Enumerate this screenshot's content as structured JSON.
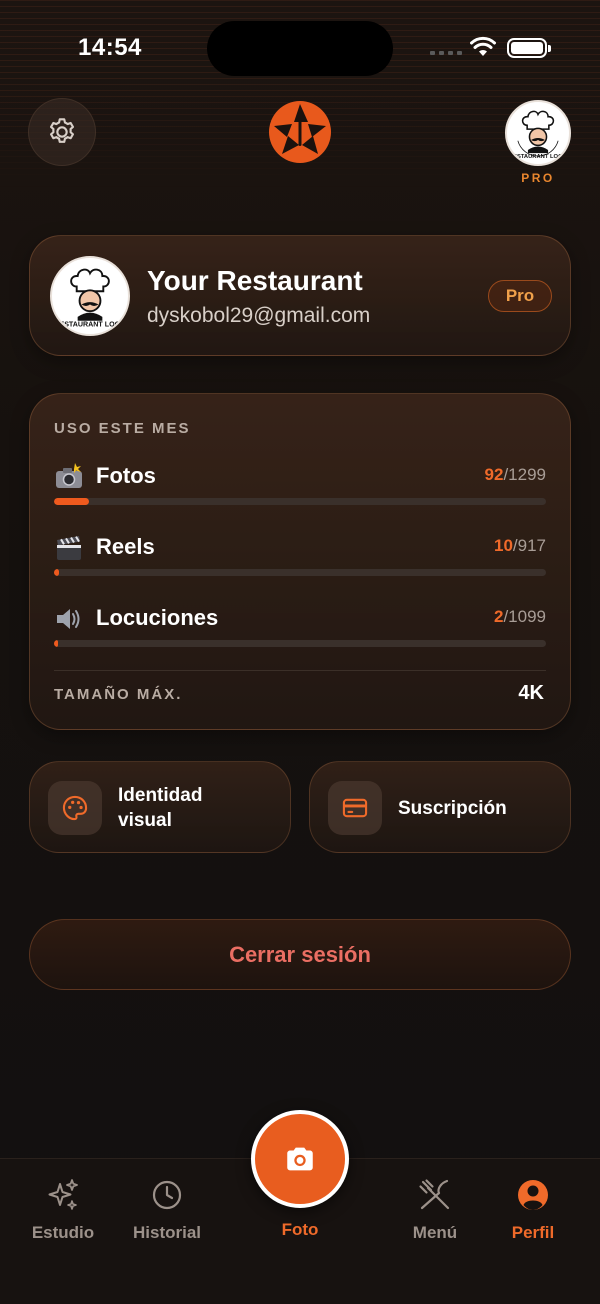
{
  "status_bar": {
    "time": "14:54"
  },
  "header": {
    "plan_label": "PRO",
    "avatar_caption": "RESTAURANT LOGO"
  },
  "profile": {
    "name": "Your Restaurant",
    "email": "dyskobol29@gmail.com",
    "plan_badge": "Pro",
    "avatar_caption": "RESTAURANT LOGO"
  },
  "usage": {
    "title": "USO ESTE MES",
    "items": [
      {
        "icon": "camera-flash-icon",
        "label": "Fotos",
        "used": "92",
        "limit": "/1299",
        "progress": 0.0708
      },
      {
        "icon": "clapper-board-icon",
        "label": "Reels",
        "used": "10",
        "limit": "/917",
        "progress": 0.0109
      },
      {
        "icon": "speaker-icon",
        "label": "Locuciones",
        "used": "2",
        "limit": "/1099",
        "progress": 0.0018
      }
    ],
    "max_size_label": "TAMAÑO MÁX.",
    "max_size_value": "4K"
  },
  "tiles": {
    "identity": {
      "icon": "palette-icon",
      "label": "Identidad visual"
    },
    "subscription": {
      "icon": "credit-card-icon",
      "label": "Suscripción"
    }
  },
  "logout_label": "Cerrar sesión",
  "tabbar": {
    "tabs": [
      {
        "icon": "sparkles-icon",
        "label": "Estudio"
      },
      {
        "icon": "clock-icon",
        "label": "Historial"
      },
      {
        "icon": "camera-icon",
        "label": "Foto"
      },
      {
        "icon": "fork-knife-icon",
        "label": "Menú"
      },
      {
        "icon": "user-circle-icon",
        "label": "Perfil"
      }
    ],
    "active": "Perfil"
  },
  "colors": {
    "accent": "#ef6a2a",
    "logout_text": "#ea6e63",
    "background": "#16110e"
  }
}
